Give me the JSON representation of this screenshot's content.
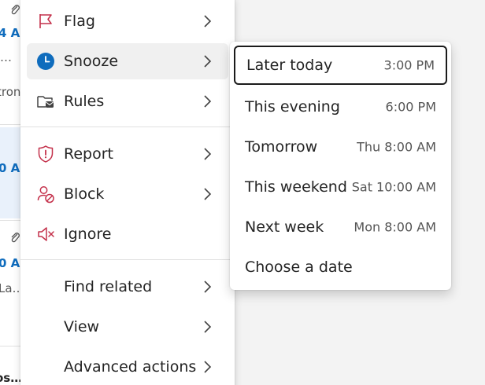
{
  "colors": {
    "accent": "#0f6cbd",
    "danger_icon": "#c4314b",
    "menu_bg": "#ffffff",
    "hover_bg": "#f0f0f0",
    "focus_border": "#1b1b1b"
  },
  "list_strip": {
    "rows": [
      {
        "time": "4 A",
        "preview": "…"
      },
      {
        "preview": "tron"
      },
      {
        "time": "0 A"
      },
      {
        "time": "0 A",
        "preview": "La…"
      },
      {
        "preview": "os…"
      }
    ]
  },
  "context_menu": {
    "items": [
      {
        "label": "Flag",
        "icon": "flag-icon"
      },
      {
        "label": "Snooze",
        "icon": "clock-icon"
      },
      {
        "label": "Rules",
        "icon": "folder-mail-icon"
      },
      {
        "label": "Report",
        "icon": "shield-alert-icon"
      },
      {
        "label": "Block",
        "icon": "block-person-icon"
      },
      {
        "label": "Ignore",
        "icon": "mute-icon"
      },
      {
        "label": "Find related"
      },
      {
        "label": "View"
      },
      {
        "label": "Advanced actions"
      }
    ]
  },
  "snooze_menu": {
    "items": [
      {
        "label": "Later today",
        "time": "3:00 PM"
      },
      {
        "label": "This evening",
        "time": "6:00 PM"
      },
      {
        "label": "Tomorrow",
        "time": "Thu 8:00 AM"
      },
      {
        "label": "This weekend",
        "time": "Sat 10:00 AM"
      },
      {
        "label": "Next week",
        "time": "Mon 8:00 AM"
      },
      {
        "label": "Choose a date"
      }
    ]
  }
}
